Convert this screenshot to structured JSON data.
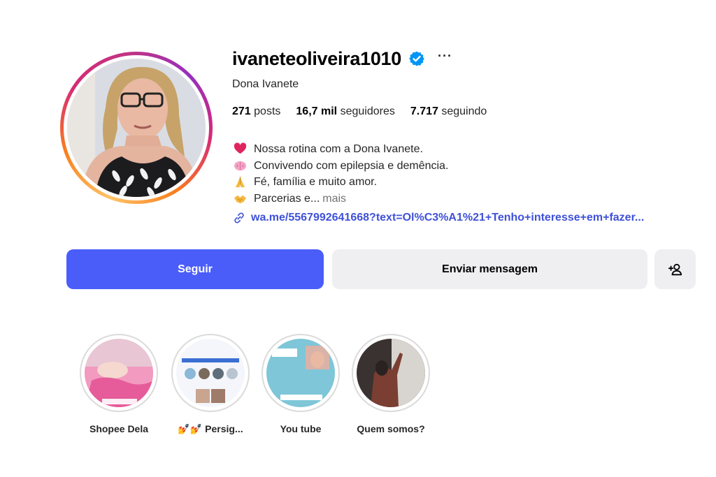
{
  "profile": {
    "username": "ivaneteoliveira1010",
    "full_name": "Dona Ivanete",
    "more_label": "···"
  },
  "stats": {
    "posts_count": "271",
    "posts_label": "posts",
    "followers_count": "16,7 mil",
    "followers_label": "seguidores",
    "following_count": "7.717",
    "following_label": "seguindo"
  },
  "bio": {
    "lines": [
      {
        "emoji": "heart-icon",
        "text": "Nossa rotina com a Dona Ivanete."
      },
      {
        "emoji": "brain-icon",
        "text": "Convivendo com epilepsia e demência."
      },
      {
        "emoji": "praying-hands-icon",
        "text": "Fé, família e muito amor."
      },
      {
        "emoji": "handshake-icon",
        "text": "Parcerias e..."
      }
    ],
    "more_label": "mais",
    "link": "wa.me/5567992641668?text=Ol%C3%A1%21+Tenho+interesse+em+fazer..."
  },
  "actions": {
    "follow_label": "Seguir",
    "message_label": "Enviar mensagem"
  },
  "highlights": [
    {
      "label": "Shopee Dela"
    },
    {
      "label": "💅💅 Persig..."
    },
    {
      "label": "You tube"
    },
    {
      "label": "Quem somos?"
    }
  ],
  "colors": {
    "follow_button": "#4a5df9",
    "secondary_button": "#efeff1",
    "link": "#3f51d8",
    "verified": "#0095f6"
  }
}
